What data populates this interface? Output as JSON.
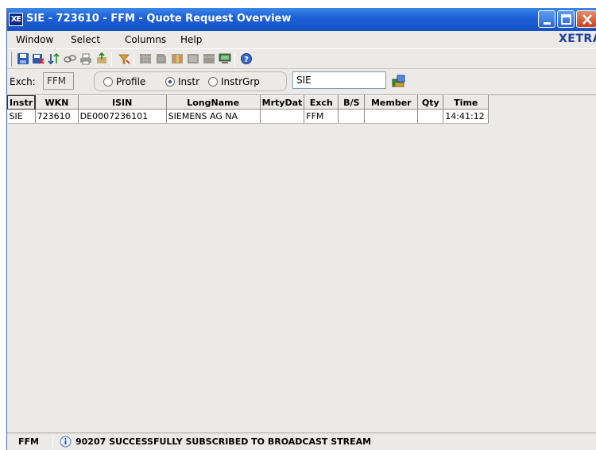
{
  "window": {
    "app_badge": "XE",
    "title": "SIE - 723610 - FFM - Quote Request Overview"
  },
  "menu": {
    "items": [
      "Window",
      "Select",
      "Columns",
      "Help"
    ],
    "brand": "XETRA"
  },
  "toolbar": {
    "icons": [
      "save-icon",
      "save-as-icon",
      "sort-icon",
      "link-icon",
      "print-icon",
      "export-icon",
      "filter-icon",
      "grid-view-icon",
      "page-view-icon",
      "column-view-icon",
      "list-view-icon",
      "table-view-icon",
      "monitor-icon",
      "help-icon"
    ]
  },
  "filter": {
    "exch_label": "Exch:",
    "exch_value": "FFM",
    "scope_options": [
      "Profile",
      "Instr",
      "InstrGrp"
    ],
    "scope_selected": "Instr",
    "instrument_value": "SIE"
  },
  "table": {
    "columns": [
      "Instr",
      "WKN",
      "ISIN",
      "LongName",
      "MrtyDat",
      "Exch",
      "B/S",
      "Member",
      "Qty",
      "Time"
    ],
    "rows": [
      [
        "SIE",
        "723610",
        "DE0007236101",
        "SIEMENS AG NA",
        "",
        "FFM",
        "",
        "",
        "",
        "14:41:12"
      ]
    ]
  },
  "status": {
    "exchange": "FFM",
    "message": "90207 SUCCESSFULLY SUBSCRIBED TO BROADCAST STREAM"
  },
  "colors": {
    "titlebar": "#1c5fd6",
    "window_bg": "#eceae6",
    "brand": "#1a3fa0"
  }
}
